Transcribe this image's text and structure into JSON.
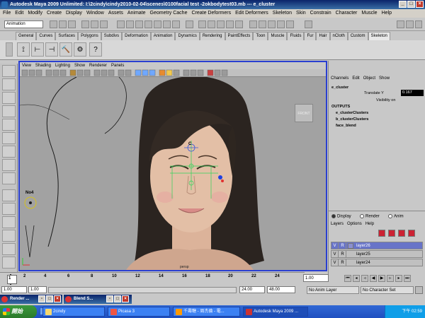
{
  "window": {
    "title": "Autodesk Maya 2009 Unlimited: I:\\2cindy\\cindy2010-02-04\\scenes\\0100facial test -2okbodytest03.mb  ---  e_cluster",
    "minimize": "_",
    "maximize": "□",
    "close": "×"
  },
  "menubar": [
    "File",
    "Edit",
    "Modify",
    "Create",
    "Display",
    "Window",
    "Assets",
    "Animate",
    "Geometry Cache",
    "Create Deformers",
    "Edit Deformers",
    "Skeleton",
    "Skin",
    "Constrain",
    "Character",
    "Muscle",
    "Help"
  ],
  "statusline": {
    "mode": "Animation"
  },
  "shelf": {
    "tabs": [
      "General",
      "Curves",
      "Surfaces",
      "Polygons",
      "Subdivs",
      "Deformation",
      "Animation",
      "Dynamics",
      "Rendering",
      "PaintEffects",
      "Toon",
      "Muscle",
      "Fluids",
      "Fur",
      "Hair",
      "nCloth",
      "Custom",
      "Skeleton"
    ],
    "active_tab": "Skeleton",
    "help_icon": "?"
  },
  "viewport": {
    "menu": [
      "View",
      "Shading",
      "Lighting",
      "Show",
      "Renderer",
      "Panels"
    ],
    "view_cube": "FRONT",
    "camera": "persp",
    "joint_label": "No4",
    "cluster_label": "C"
  },
  "channelbox": {
    "menu": [
      "Channels",
      "Edit",
      "Object",
      "Show"
    ],
    "node": "e_cluster",
    "attrs": [
      {
        "name": "Translate Y",
        "value": "0.167"
      },
      {
        "name": "Visibility",
        "value": "on"
      }
    ],
    "outputs_header": "OUTPUTS",
    "outputs": [
      "e_clusterClusters",
      "b_clusterClusters",
      "face_blend"
    ]
  },
  "layereditor": {
    "radios": [
      {
        "label": "Display",
        "selected": true
      },
      {
        "label": "Render",
        "selected": false
      },
      {
        "label": "Anim",
        "selected": false
      }
    ],
    "menu": [
      "Layers",
      "Options",
      "Help"
    ],
    "layers": [
      {
        "v": "V",
        "r": "R",
        "name": "layer26",
        "selected": true
      },
      {
        "v": "V",
        "r": "R",
        "name": "layer25",
        "selected": false
      },
      {
        "v": "V",
        "r": "R",
        "name": "layer24",
        "selected": false
      }
    ]
  },
  "timeline": {
    "ticks": [
      "2",
      "4",
      "6",
      "8",
      "10",
      "12",
      "14",
      "16",
      "18",
      "20",
      "22",
      "24"
    ],
    "current_frame": "1.00",
    "start": "1"
  },
  "range": {
    "start": "1.00",
    "inner_start": "1.00",
    "end": "24.00",
    "outer_end": "48.00",
    "anim_layer": "No Anim Layer",
    "char_set": "No Character Set"
  },
  "floating": [
    {
      "label": "Render ..."
    },
    {
      "label": "Blend S..."
    }
  ],
  "taskbar": {
    "start": "開始",
    "tasks": [
      "2cindy",
      "Picasa 3",
      "千壽糖 - 周杰倫 - 電...",
      "Autodesk Maya 2009 ..."
    ],
    "clock": "下午 02:59"
  }
}
